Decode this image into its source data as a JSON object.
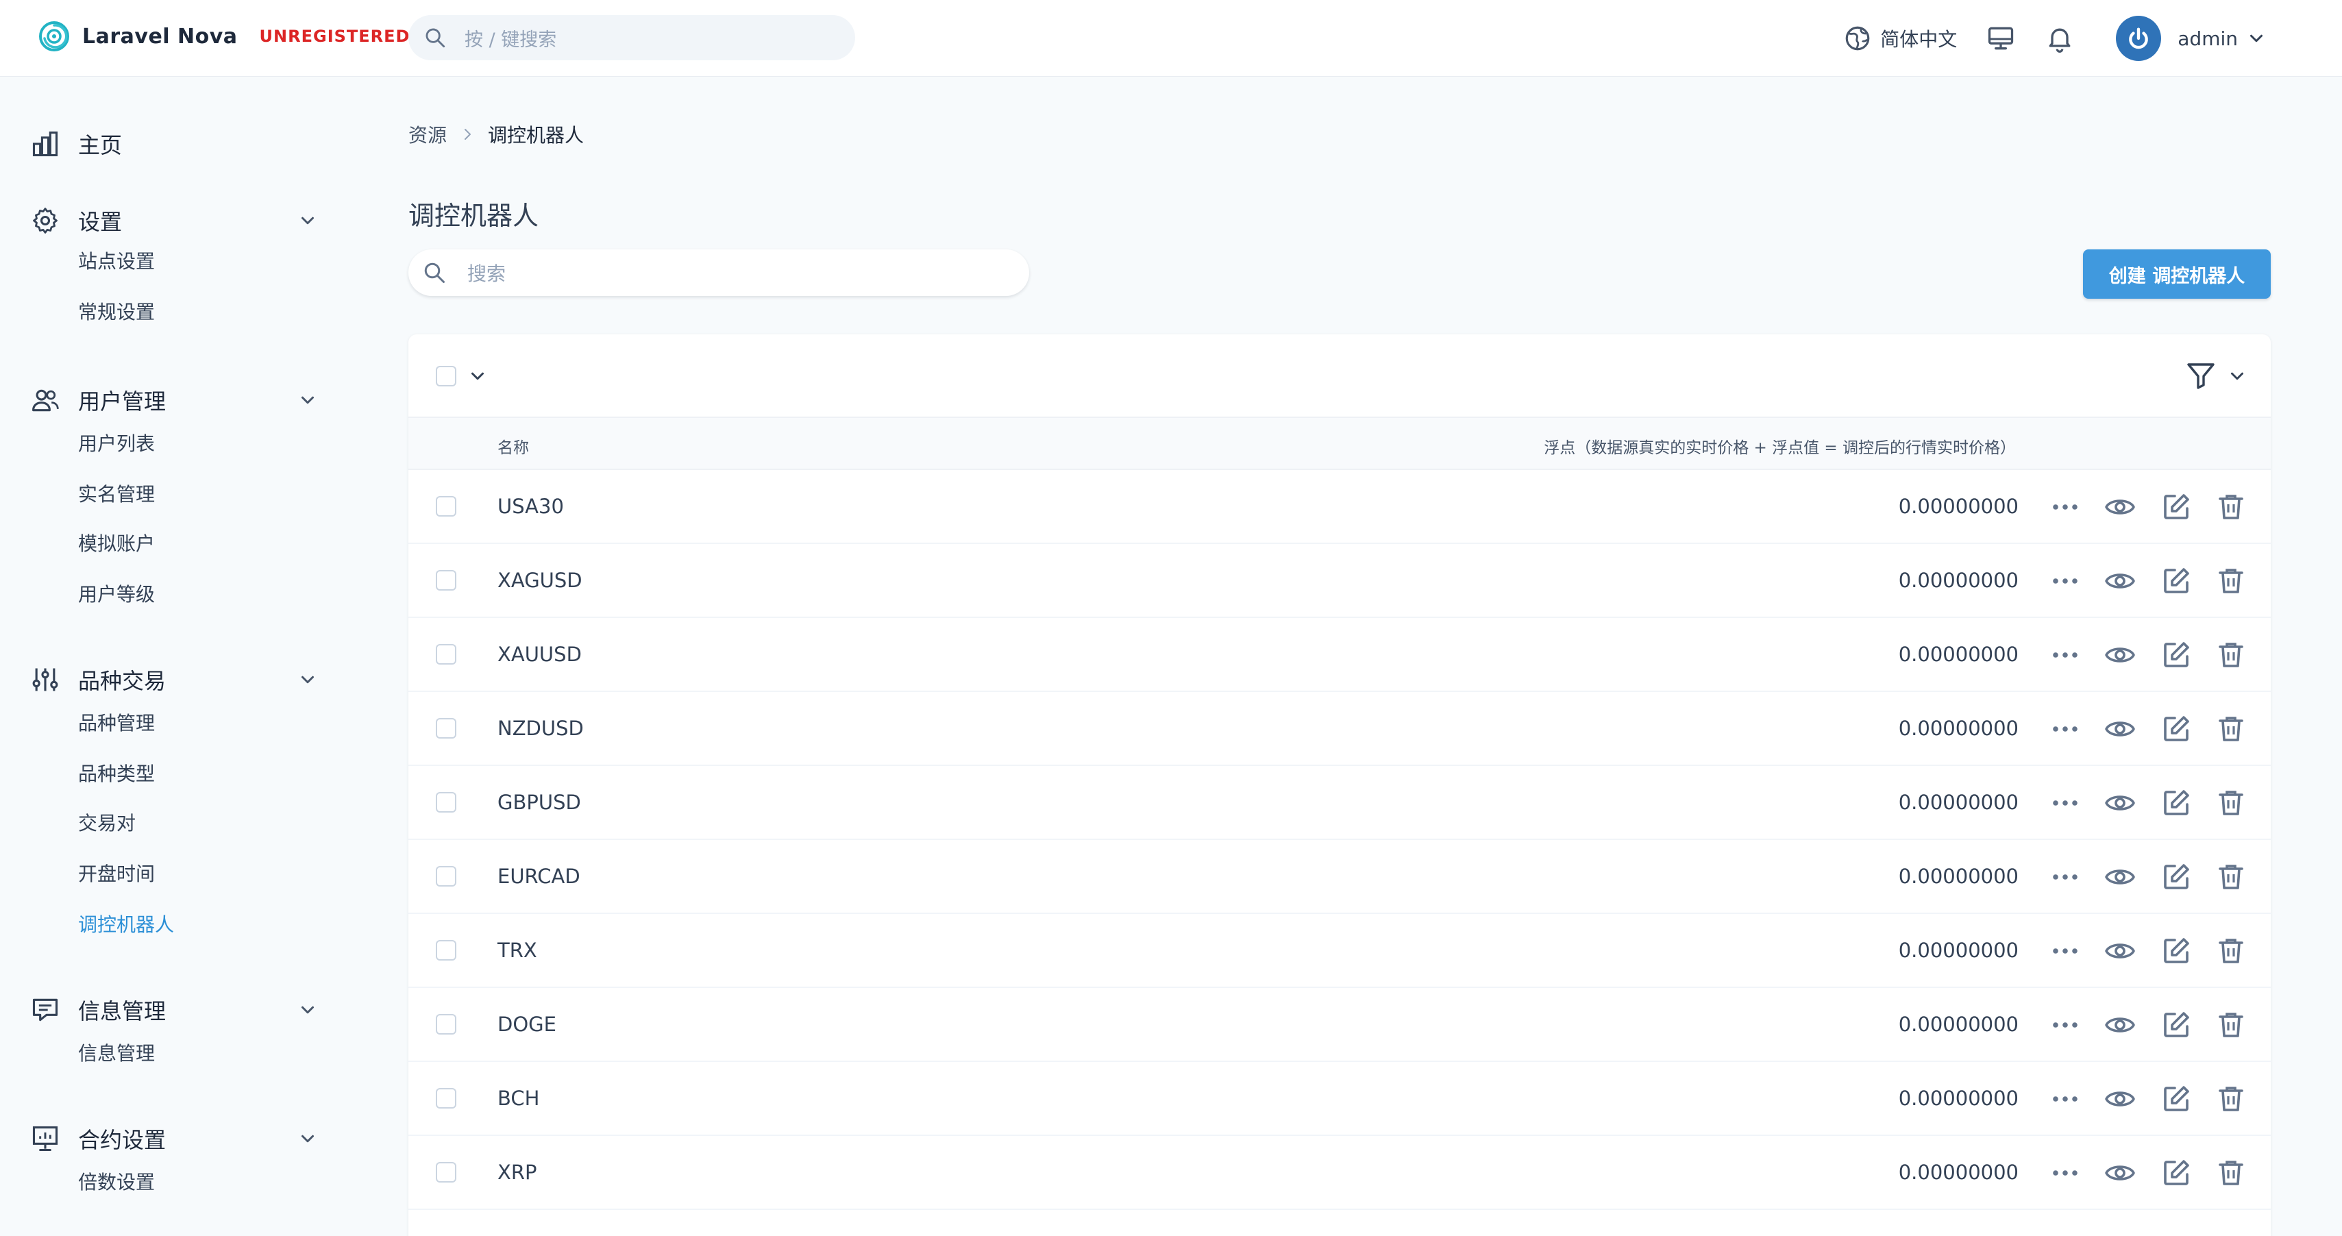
{
  "app": {
    "name": "Laravel Nova",
    "badge": "UNREGISTERED",
    "search_placeholder": "按 / 键搜索",
    "language": "简体中文",
    "user": "admin"
  },
  "sidebar": {
    "home": "主页",
    "groups": [
      {
        "label": "设置",
        "icon": "gear-icon",
        "items": [
          "站点设置",
          "常规设置"
        ]
      },
      {
        "label": "用户管理",
        "icon": "users-icon",
        "items": [
          "用户列表",
          "实名管理",
          "模拟账户",
          "用户等级"
        ]
      },
      {
        "label": "品种交易",
        "icon": "sliders-icon",
        "items": [
          "品种管理",
          "品种类型",
          "交易对",
          "开盘时间",
          "调控机器人"
        ]
      },
      {
        "label": "信息管理",
        "icon": "chat-icon",
        "items": [
          "信息管理"
        ]
      },
      {
        "label": "合约设置",
        "icon": "presentation-icon",
        "items": [
          "倍数设置"
        ]
      }
    ],
    "active_item": "调控机器人"
  },
  "breadcrumb": [
    "资源",
    "调控机器人"
  ],
  "page": {
    "title": "调控机器人",
    "search_placeholder": "搜索",
    "create_button": "创建 调控机器人"
  },
  "table": {
    "columns": [
      "名称",
      "浮点（数据源真实的实时价格 + 浮点值 = 调控后的行情实时价格）"
    ],
    "rows": [
      {
        "name": "USA30",
        "float": "0.00000000"
      },
      {
        "name": "XAGUSD",
        "float": "0.00000000"
      },
      {
        "name": "XAUUSD",
        "float": "0.00000000"
      },
      {
        "name": "NZDUSD",
        "float": "0.00000000"
      },
      {
        "name": "GBPUSD",
        "float": "0.00000000"
      },
      {
        "name": "EURCAD",
        "float": "0.00000000"
      },
      {
        "name": "TRX",
        "float": "0.00000000"
      },
      {
        "name": "DOGE",
        "float": "0.00000000"
      },
      {
        "name": "BCH",
        "float": "0.00000000"
      },
      {
        "name": "XRP",
        "float": "0.00000000"
      }
    ]
  },
  "colors": {
    "accent": "#4099de",
    "active_link": "#2b8fd6",
    "badge_red": "#dc2626",
    "avatar_blue": "#2f73b8",
    "icon_gray": "#64748b"
  }
}
